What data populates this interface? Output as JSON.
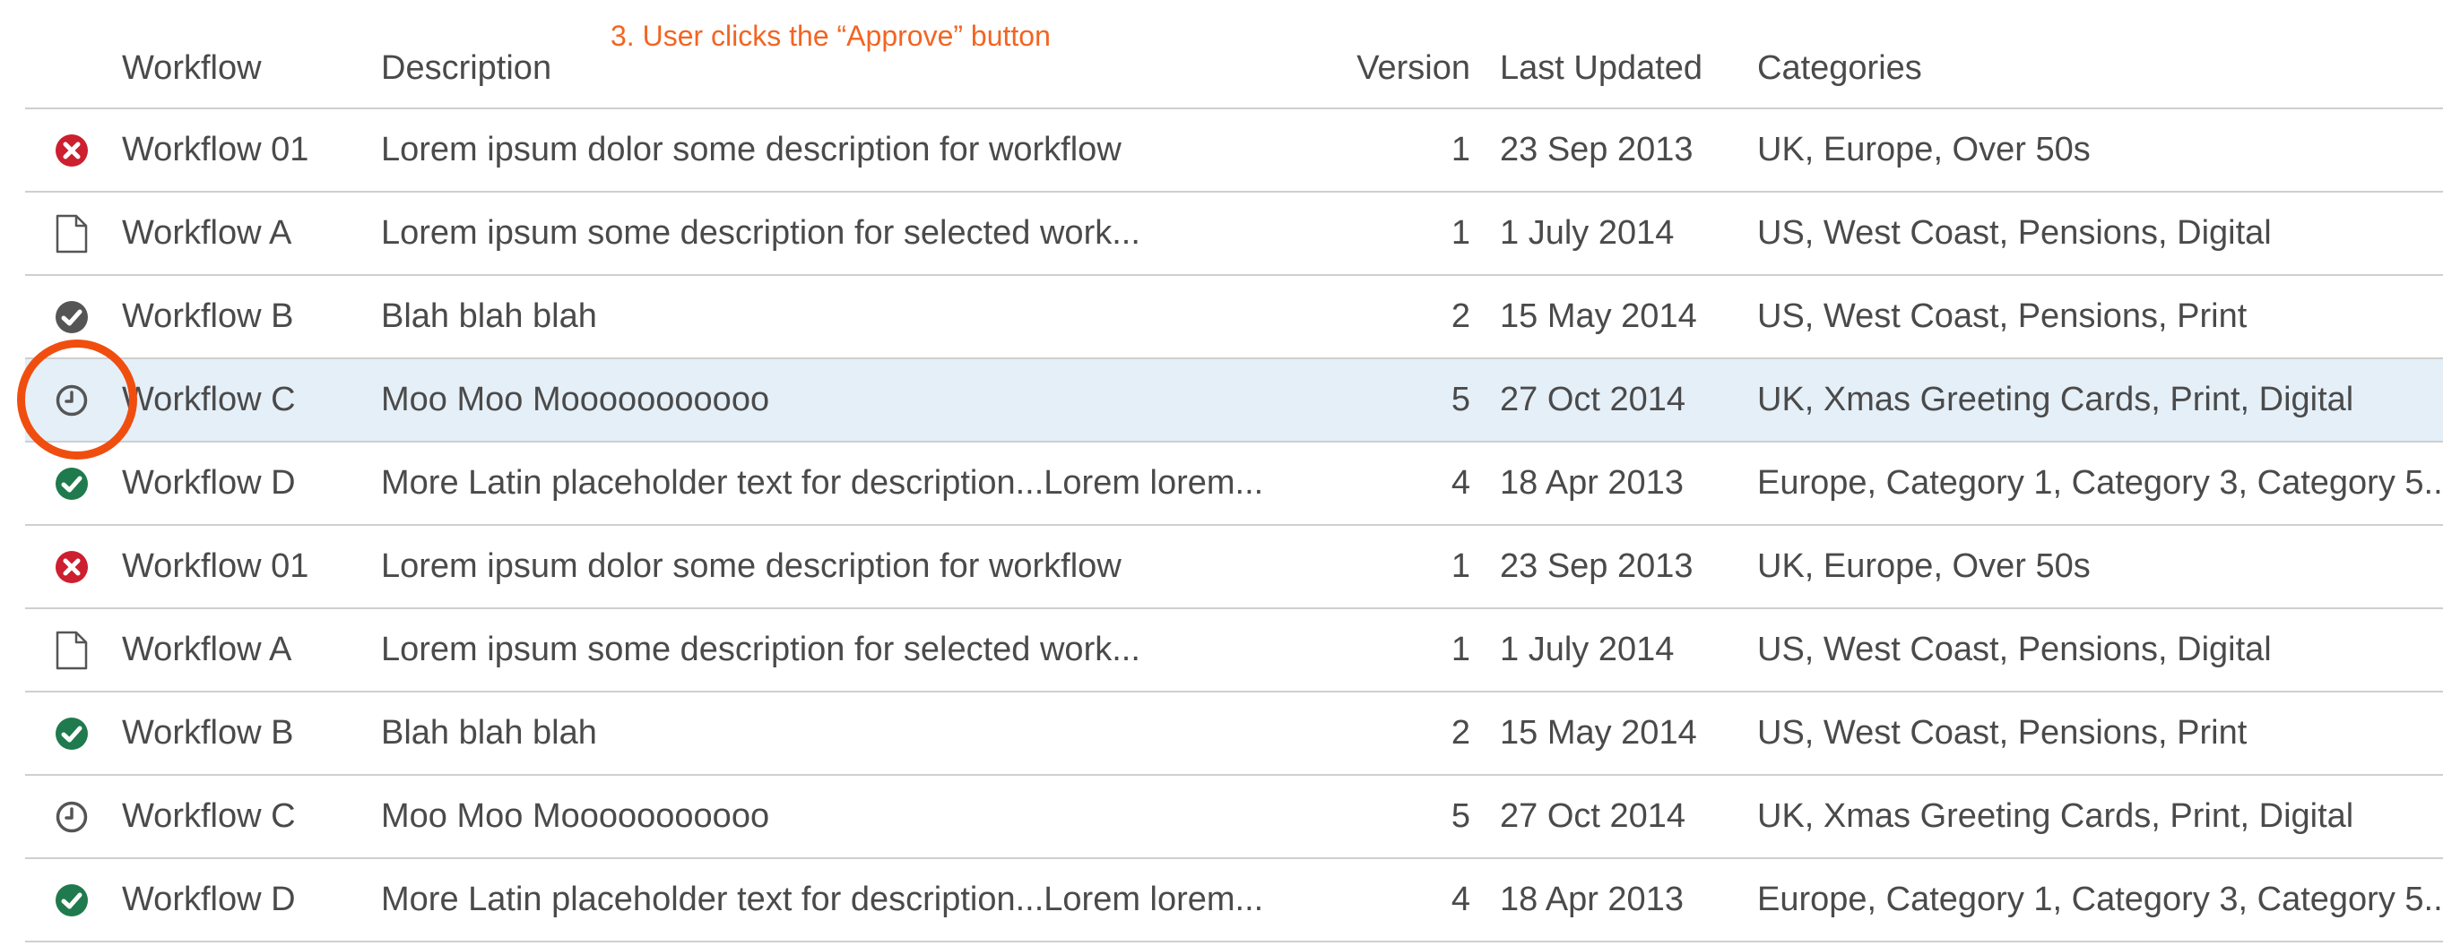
{
  "annotation": "3. User clicks the “Approve” button",
  "columns": {
    "workflow": "Workflow",
    "description": "Description",
    "version": "Version",
    "last_updated": "Last Updated",
    "categories": "Categories"
  },
  "status_colors": {
    "rejected": "#cc1f2f",
    "approved": "#1f7a4d",
    "checked": "#555555",
    "pending": "#555555",
    "draft": "#555555"
  },
  "rows": [
    {
      "status_icon": "rejected-icon",
      "workflow": "Workflow 01",
      "description": "Lorem ipsum dolor some description for workflow",
      "version": "1",
      "last_updated": "23 Sep 2013",
      "categories": "UK, Europe, Over 50s"
    },
    {
      "status_icon": "document-icon",
      "workflow": "Workflow A",
      "description": "Lorem ipsum some description for selected work...",
      "version": "1",
      "last_updated": "1 July 2014",
      "categories": "US, West Coast, Pensions, Digital"
    },
    {
      "status_icon": "checked-gray-icon",
      "workflow": "Workflow B",
      "description": "Blah blah blah",
      "version": "2",
      "last_updated": "15 May 2014",
      "categories": "US, West Coast, Pensions, Print"
    },
    {
      "status_icon": "clock-icon",
      "workflow": "Workflow C",
      "description": "Moo Moo Mooooooooooo",
      "version": "5",
      "last_updated": "27 Oct 2014",
      "categories": "UK, Xmas Greeting Cards, Print, Digital",
      "selected": true
    },
    {
      "status_icon": "approved-icon",
      "workflow": "Workflow D",
      "description": "More Latin placeholder text for description...Lorem lorem...",
      "version": "4",
      "last_updated": "18 Apr 2013",
      "categories": "Europe, Category 1, Category 3, Category 5..."
    },
    {
      "status_icon": "rejected-icon",
      "workflow": "Workflow 01",
      "description": "Lorem ipsum dolor some description for workflow",
      "version": "1",
      "last_updated": "23 Sep 2013",
      "categories": "UK, Europe, Over 50s"
    },
    {
      "status_icon": "document-icon",
      "workflow": "Workflow A",
      "description": "Lorem ipsum some description for selected work...",
      "version": "1",
      "last_updated": "1 July 2014",
      "categories": "US, West Coast, Pensions, Digital"
    },
    {
      "status_icon": "approved-icon",
      "workflow": "Workflow B",
      "description": "Blah blah blah",
      "version": "2",
      "last_updated": "15 May 2014",
      "categories": "US, West Coast, Pensions, Print"
    },
    {
      "status_icon": "clock-icon",
      "workflow": "Workflow C",
      "description": "Moo Moo Mooooooooooo",
      "version": "5",
      "last_updated": "27 Oct 2014",
      "categories": "UK, Xmas Greeting Cards, Print, Digital"
    },
    {
      "status_icon": "approved-icon",
      "workflow": "Workflow D",
      "description": "More Latin placeholder text for description...Lorem lorem...",
      "version": "4",
      "last_updated": "18 Apr 2013",
      "categories": "Europe, Category 1, Category 3, Category 5..."
    }
  ]
}
